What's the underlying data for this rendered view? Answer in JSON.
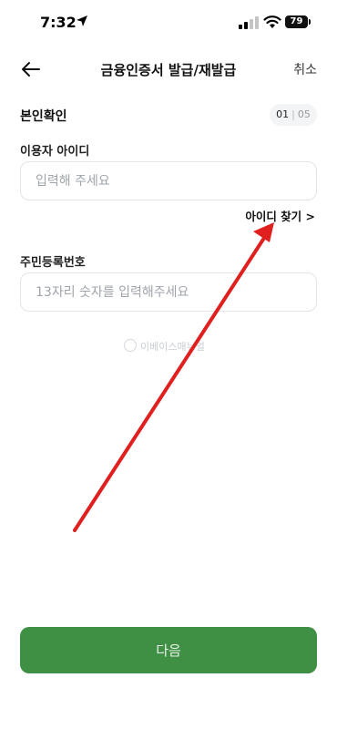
{
  "status_bar": {
    "time": "7:32",
    "battery": "79"
  },
  "header": {
    "title": "금융인증서 발급/재발급",
    "cancel_label": "취소"
  },
  "section": {
    "title": "본인확인",
    "step_current": "01",
    "step_separator": "|",
    "step_total": "05"
  },
  "user_id": {
    "label": "이용자 아이디",
    "placeholder": "입력해 주세요",
    "value": ""
  },
  "find_id": {
    "label": "아이디 찾기 >"
  },
  "resident_number": {
    "label": "주민등록번호",
    "placeholder": "13자리 숫자를 입력해주세요",
    "value": ""
  },
  "watermark": {
    "text": "이베이스매뉴얼"
  },
  "next_button": {
    "label": "다음"
  },
  "annotation": {
    "arrow_color": "#e0201f"
  },
  "colors": {
    "primary_button": "#3f8f45"
  }
}
